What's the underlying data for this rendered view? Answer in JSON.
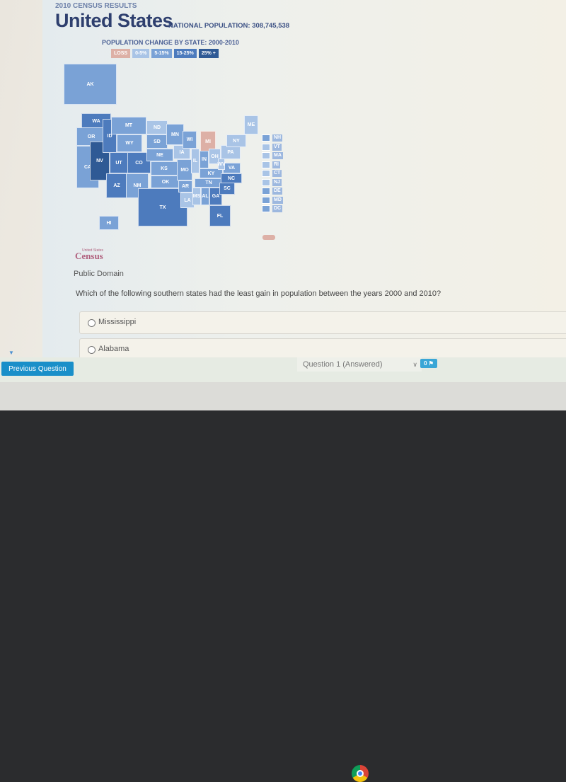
{
  "header": {
    "small_title": "2010 CENSUS RESULTS",
    "title": "United States",
    "national_population": "NATIONAL POPULATION: 308,745,538",
    "subtitle": "POPULATION CHANGE BY STATE: 2000-2010"
  },
  "legend": [
    {
      "label": "LOSS",
      "color": "#ddb0a6"
    },
    {
      "label": "0-5%",
      "color": "#a9c4e6"
    },
    {
      "label": "5-15%",
      "color": "#7aa2d6"
    },
    {
      "label": "15-25%",
      "color": "#4d7bbd"
    },
    {
      "label": "25% +",
      "color": "#2f5a95"
    }
  ],
  "map": {
    "states": [
      {
        "abbr": "AK",
        "cat": "5"
      },
      {
        "abbr": "HI",
        "cat": "5"
      },
      {
        "abbr": "WA",
        "cat": "15"
      },
      {
        "abbr": "OR",
        "cat": "5"
      },
      {
        "abbr": "CA",
        "cat": "5"
      },
      {
        "abbr": "NV",
        "cat": "25"
      },
      {
        "abbr": "ID",
        "cat": "15"
      },
      {
        "abbr": "MT",
        "cat": "5"
      },
      {
        "abbr": "WY",
        "cat": "5"
      },
      {
        "abbr": "UT",
        "cat": "15"
      },
      {
        "abbr": "CO",
        "cat": "15"
      },
      {
        "abbr": "AZ",
        "cat": "15"
      },
      {
        "abbr": "NM",
        "cat": "5"
      },
      {
        "abbr": "ND",
        "cat": "0"
      },
      {
        "abbr": "SD",
        "cat": "5"
      },
      {
        "abbr": "NE",
        "cat": "5"
      },
      {
        "abbr": "KS",
        "cat": "5"
      },
      {
        "abbr": "OK",
        "cat": "5"
      },
      {
        "abbr": "TX",
        "cat": "15"
      },
      {
        "abbr": "MN",
        "cat": "5"
      },
      {
        "abbr": "IA",
        "cat": "0"
      },
      {
        "abbr": "MO",
        "cat": "5"
      },
      {
        "abbr": "AR",
        "cat": "5"
      },
      {
        "abbr": "LA",
        "cat": "0"
      },
      {
        "abbr": "WI",
        "cat": "5"
      },
      {
        "abbr": "IL",
        "cat": "0"
      },
      {
        "abbr": "MI",
        "cat": "loss"
      },
      {
        "abbr": "IN",
        "cat": "5"
      },
      {
        "abbr": "OH",
        "cat": "0"
      },
      {
        "abbr": "KY",
        "cat": "5"
      },
      {
        "abbr": "TN",
        "cat": "5"
      },
      {
        "abbr": "MS",
        "cat": "0"
      },
      {
        "abbr": "AL",
        "cat": "5"
      },
      {
        "abbr": "GA",
        "cat": "15"
      },
      {
        "abbr": "FL",
        "cat": "15"
      },
      {
        "abbr": "SC",
        "cat": "15"
      },
      {
        "abbr": "NC",
        "cat": "15"
      },
      {
        "abbr": "VA",
        "cat": "5"
      },
      {
        "abbr": "WV",
        "cat": "0"
      },
      {
        "abbr": "PA",
        "cat": "0"
      },
      {
        "abbr": "NY",
        "cat": "0"
      },
      {
        "abbr": "ME",
        "cat": "0"
      }
    ],
    "northeast": [
      {
        "abbr": "NH",
        "cat": "5"
      },
      {
        "abbr": "VT",
        "cat": "0"
      },
      {
        "abbr": "MA",
        "cat": "0"
      },
      {
        "abbr": "RI",
        "cat": "0"
      },
      {
        "abbr": "CT",
        "cat": "0"
      },
      {
        "abbr": "NJ",
        "cat": "0"
      },
      {
        "abbr": "DE",
        "cat": "5"
      },
      {
        "abbr": "MD",
        "cat": "5"
      },
      {
        "abbr": "DC",
        "cat": "5"
      }
    ]
  },
  "credit": {
    "logo_small": "United States",
    "logo": "Census",
    "license": "Public Domain"
  },
  "question": {
    "text": "Which of the following southern states had the least gain in population between the years 2000 and 2010?",
    "options": [
      "Mississippi",
      "Alabama"
    ]
  },
  "nav": {
    "previous_label": "Previous Question",
    "question_select": "Question 1 (Answered)",
    "flag_count": "0"
  }
}
